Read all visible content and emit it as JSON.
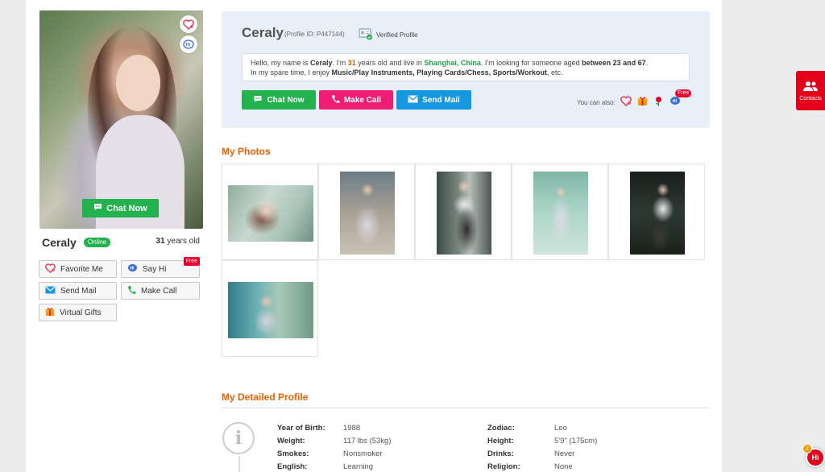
{
  "profile": {
    "name": "Ceraly",
    "profile_id": "(Profile ID: P447144)",
    "verified_label": "Verified Profile",
    "online_label": "Online",
    "age": "31",
    "age_suffix": " years old"
  },
  "bio": {
    "p1": "Hello, my name is ",
    "name": "Ceraly",
    "p2": ". I'm ",
    "age": "31",
    "p3": " years old and live in ",
    "city": "Shanghai, China",
    "p4": ". I'm looking for someone aged ",
    "range": "between 23 and 67",
    "p5": ".",
    "p6": "In my spare time, I enjoy ",
    "hobbies": "Music/Play Instruments, Playing Cards/Chess, Sports/Workout",
    "p7": ", etc."
  },
  "left_actions": {
    "chat_now": "Chat Now",
    "favorite": "Favorite Me",
    "say_hi": "Say Hi",
    "free": "Free",
    "send_mail": "Send Mail",
    "make_call": "Make Call",
    "virtual_gifts": "Virtual Gifts"
  },
  "contact_actions": {
    "chat_now": "Chat Now",
    "make_call": "Make Call",
    "send_mail": "Send Mail",
    "you_can_also": "You can also:",
    "free": "Free"
  },
  "sections": {
    "photos": "My Photos",
    "detailed": "My Detailed Profile"
  },
  "photos_count": 6,
  "details": [
    {
      "label": "Year of Birth:",
      "value": "1988",
      "label2": "Zodiac:",
      "value2": "Leo"
    },
    {
      "label": "Weight:",
      "value": "117 lbs (53kg)",
      "label2": "Height:",
      "value2": "5'9\" (175cm)"
    },
    {
      "label": "Smokes:",
      "value": "Nonsmoker",
      "label2": "Drinks:",
      "value2": "Never"
    },
    {
      "label": "English:",
      "value": "Learning",
      "label2": "Religion:",
      "value2": "None"
    }
  ],
  "sidebar": {
    "contacts_label": "Contacts",
    "hi_label": "Hi",
    "hi_count": "2"
  },
  "colors": {
    "green": "#22b14c",
    "pink": "#ef1e74",
    "blue": "#1597e0",
    "accent_orange": "#f06000",
    "red": "#e4001b"
  }
}
